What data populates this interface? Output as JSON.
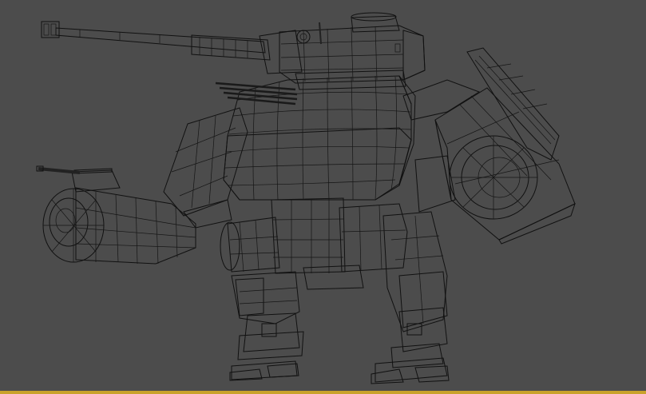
{
  "viewport": {
    "background_color": "#4c4c4c",
    "active_border_color": "#c9a22a",
    "shading_mode": "shaded-with-wireframe",
    "mesh_color": "#8a8a8a",
    "wire_color": "#111111"
  },
  "scene": {
    "subject": "mech-model",
    "parts": [
      {
        "name": "tank-turret"
      },
      {
        "name": "main-cannon"
      },
      {
        "name": "torso"
      },
      {
        "name": "left-arm-cannon"
      },
      {
        "name": "right-arm-launcher"
      },
      {
        "name": "hip-block"
      },
      {
        "name": "left-leg"
      },
      {
        "name": "right-leg"
      },
      {
        "name": "left-foot"
      },
      {
        "name": "right-foot"
      }
    ]
  }
}
